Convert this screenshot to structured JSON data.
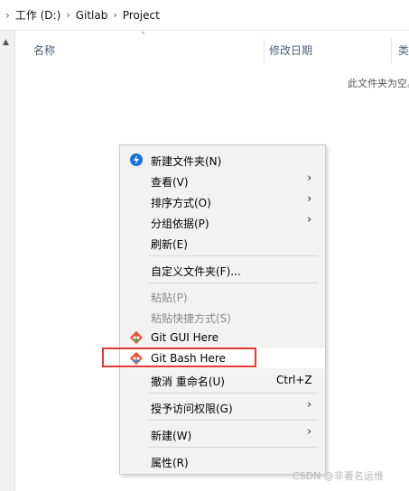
{
  "address": {
    "crumbs": [
      "工作 (D:)",
      "Gitlab",
      "Project"
    ]
  },
  "columns": {
    "name": "名称",
    "date": "修改日期",
    "type": "类"
  },
  "empty_message": "此文件夹为空。",
  "menu": {
    "items": [
      {
        "label": "新建文件夹(N)",
        "icon": "new-folder-icon"
      },
      {
        "label": "查看(V)",
        "submenu": true
      },
      {
        "label": "排序方式(O)",
        "submenu": true
      },
      {
        "label": "分组依据(P)",
        "submenu": true
      },
      {
        "label": "刷新(E)"
      },
      {
        "label": "自定义文件夹(F)..."
      },
      {
        "label": "粘贴(P)",
        "disabled": true
      },
      {
        "label": "粘贴快捷方式(S)",
        "disabled": true
      },
      {
        "label": "Git GUI Here",
        "icon": "git-icon"
      },
      {
        "label": "Git Bash Here",
        "icon": "git-icon",
        "highlighted": true
      },
      {
        "label": "撤消 重命名(U)",
        "shortcut": "Ctrl+Z"
      },
      {
        "label": "授予访问权限(G)",
        "submenu": true
      },
      {
        "label": "新建(W)",
        "submenu": true
      },
      {
        "label": "属性(R)"
      }
    ]
  },
  "colors": {
    "highlight_box": "#e53935",
    "menu_bg": "#f2f2f2"
  },
  "watermark": "CSDN @非著名运维"
}
